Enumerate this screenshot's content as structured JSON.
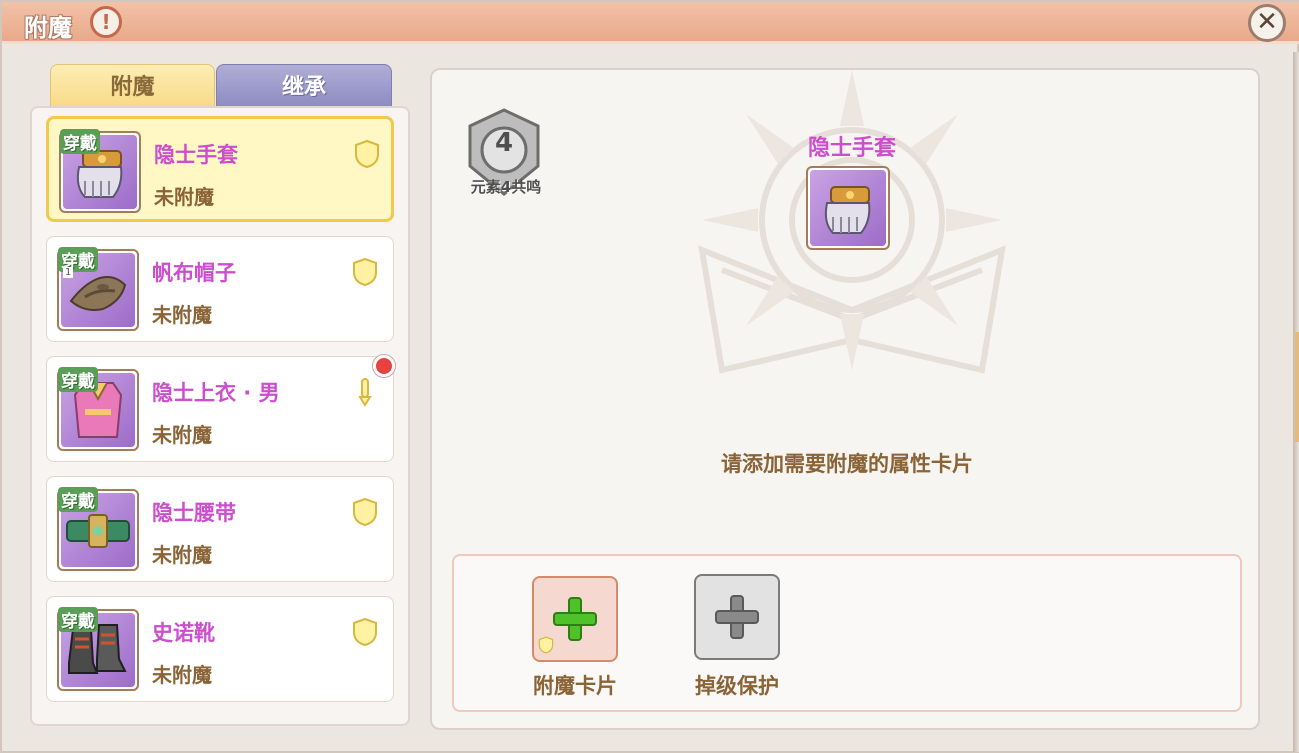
{
  "window": {
    "title": "附魔",
    "alert_icon": "!",
    "close_icon": "✕"
  },
  "tabs": [
    {
      "label": "附魔",
      "active": true
    },
    {
      "label": "继承",
      "active": false
    }
  ],
  "items": [
    {
      "badge": "穿戴",
      "name": "隐士手套",
      "status": "未附魔",
      "icon": "gauntlet-icon",
      "marker": "shield-icon",
      "selected": true
    },
    {
      "badge": "穿戴",
      "name": "帆布帽子",
      "status": "未附魔",
      "icon": "hat-icon",
      "marker": "shield-icon",
      "refine_level": "1"
    },
    {
      "badge": "穿戴",
      "name": "隐士上衣 · 男",
      "status": "未附魔",
      "icon": "shirt-icon",
      "marker": "key-icon",
      "notification": true
    },
    {
      "badge": "穿戴",
      "name": "隐士腰带",
      "status": "未附魔",
      "icon": "belt-icon",
      "marker": "shield-icon"
    },
    {
      "badge": "穿戴",
      "name": "史诺靴",
      "status": "未附魔",
      "icon": "boots-icon",
      "marker": "shield-icon"
    }
  ],
  "detail": {
    "resonance_level": "4",
    "resonance_label": "元素4共鸣",
    "selected_item_name": "隐士手套",
    "hint": "请添加需要附魔的属性卡片",
    "slots": [
      {
        "label": "附魔卡片",
        "icon": "plus-icon",
        "color": "#4fc22a"
      },
      {
        "label": "掉级保护",
        "icon": "plus-icon",
        "color": "#7a7a7a"
      }
    ]
  },
  "colors": {
    "item_name": "#cc4ecf",
    "status_text": "#8a6336",
    "selected_card_bg": "#fff7c4",
    "selected_card_border": "#f2c94c",
    "titlebar": "#e9a98a"
  }
}
